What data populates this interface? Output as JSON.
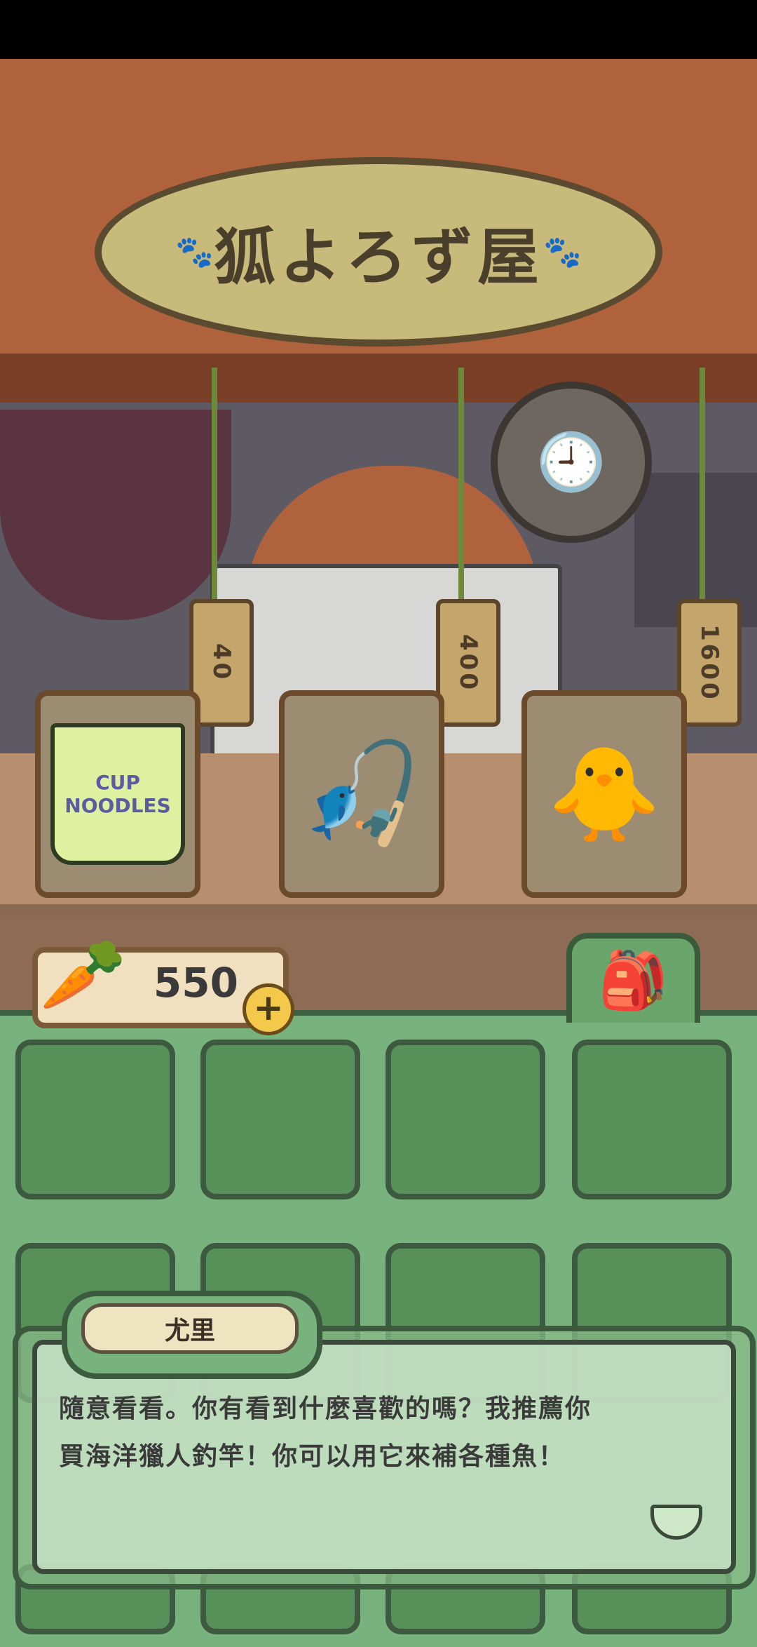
{
  "shop": {
    "sign_text": "狐よろず屋"
  },
  "items": [
    {
      "name": "cup-noodles",
      "label": "CUP NOODLES",
      "price": "40"
    },
    {
      "name": "fishing-rod",
      "price": "400"
    },
    {
      "name": "rubber-duck",
      "price": "1600"
    }
  ],
  "currency": {
    "icon": "carrot-icon",
    "value": "550",
    "add_icon": "plus-icon"
  },
  "inventory": {
    "tab_icon": "backpack-icon"
  },
  "dialog": {
    "speaker": "尤里",
    "line1": "隨意看看。你有看到什麼喜歡的嗎？我推薦你",
    "line2": "買海洋獵人釣竿！你可以用它來補各種魚！",
    "next_icon": "next-arrow-icon"
  },
  "colors": {
    "roof": "#b0623d",
    "inventory_bg": "#78b37d",
    "slot": "#589059",
    "dialog_bg": "#c5e0c4"
  }
}
